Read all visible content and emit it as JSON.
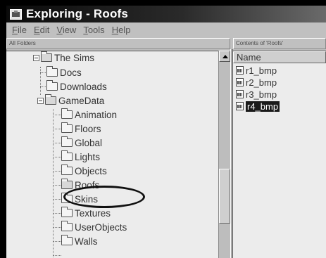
{
  "window": {
    "title": "Exploring - Roofs"
  },
  "menu": [
    {
      "label": "File",
      "key": "F",
      "rest": "ile"
    },
    {
      "label": "Edit",
      "key": "E",
      "rest": "dit"
    },
    {
      "label": "View",
      "key": "V",
      "rest": "iew"
    },
    {
      "label": "Tools",
      "key": "T",
      "rest": "ools"
    },
    {
      "label": "Help",
      "key": "H",
      "rest": "elp"
    }
  ],
  "left_header": "All Folders",
  "right_header": "Contents of 'Roofs'",
  "tree": {
    "the_sims": "The Sims",
    "docs": "Docs",
    "downloads": "Downloads",
    "gamedata": "GameData",
    "animation": "Animation",
    "floors": "Floors",
    "global": "Global",
    "lights": "Lights",
    "objects": "Objects",
    "roofs": "Roofs",
    "skins": "Skins",
    "textures": "Textures",
    "userobjects": "UserObjects",
    "walls": "Walls"
  },
  "list": {
    "column_name": "Name",
    "files": [
      "r1_bmp",
      "r2_bmp",
      "r3_bmp",
      "r4_bmp"
    ],
    "selected_file": "r4_bmp"
  },
  "icons": {
    "app": "explorer-icon",
    "folder": "folder-icon",
    "file": "bitmap-file-icon"
  }
}
